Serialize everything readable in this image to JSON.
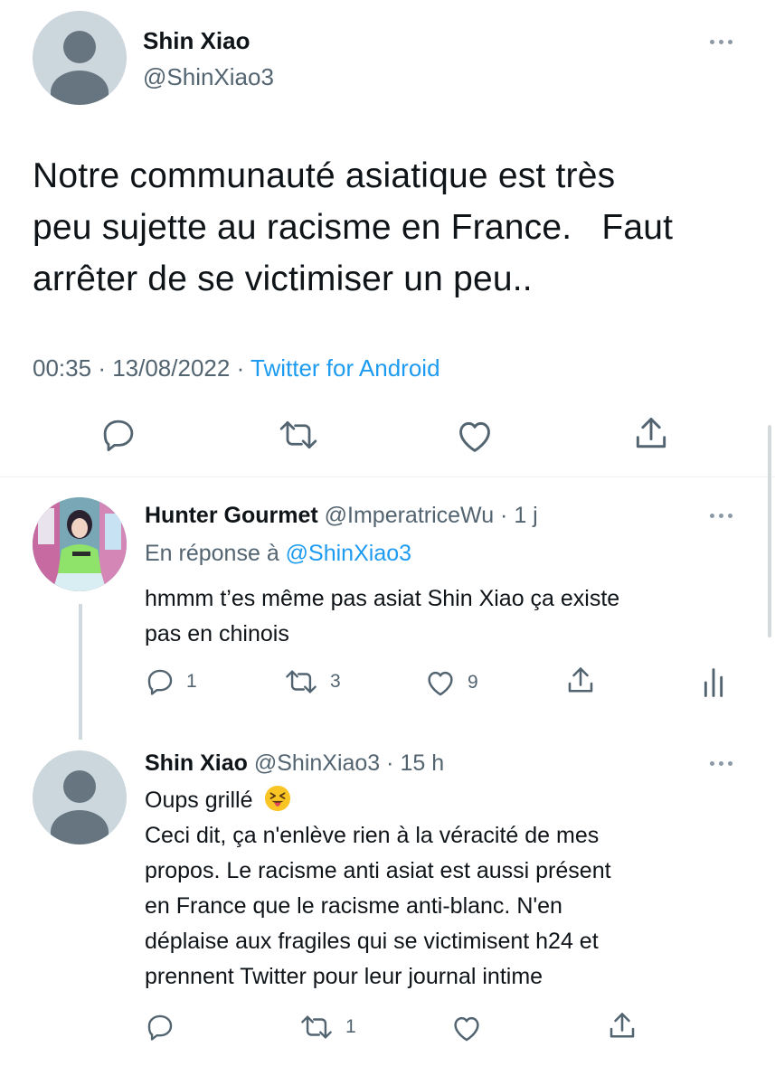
{
  "main_tweet": {
    "name": "Shin Xiao",
    "handle": "@ShinXiao3",
    "text_line1": "Notre communauté asiatique est très",
    "text_line2": "peu sujette au racisme en France.   Faut",
    "text_line3": "arrêter de se victimiser un peu..",
    "time": "00:35",
    "date": "13/08/2022",
    "source": "Twitter for Android",
    "actions": [
      "reply-icon",
      "retweet-icon",
      "like-icon",
      "share-icon"
    ]
  },
  "reply1": {
    "name": "Hunter Gourmet",
    "handle": "@ImperatriceWu",
    "age": "1 j",
    "replying_prefix": "En réponse à",
    "replying_to": "@ShinXiao3",
    "text_line1": "hmmm t’es même pas asiat Shin Xiao ça existe",
    "text_line2": "pas en chinois",
    "reply_count": "1",
    "retweet_count": "3",
    "like_count": "9"
  },
  "reply2": {
    "name": "Shin Xiao",
    "handle": "@ShinXiao3",
    "age": "15 h",
    "text_line1": "Oups grillé",
    "text_line2": "Ceci dit, ça n'enlève rien à la véracité de mes",
    "text_line3": "propos. Le racisme anti asiat est aussi présent",
    "text_line4": "en France que le racisme anti-blanc. N'en",
    "text_line5": "déplaise aux fragiles qui se victimisent h24 et",
    "text_line6": "prennent Twitter pour leur journal intime",
    "retweet_count": "1"
  },
  "colors": {
    "text": "#0f1419",
    "secondary": "#536471",
    "link": "#1d9bf0",
    "avatar_bg": "#ccd6dd",
    "avatar_fg": "#66757f"
  }
}
